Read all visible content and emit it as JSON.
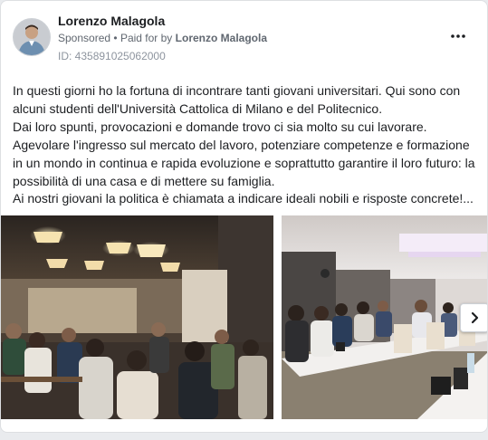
{
  "post": {
    "author": "Lorenzo Malagola",
    "sponsored_label": "Sponsored",
    "separator": "•",
    "paid_for_by_prefix": "Paid for by",
    "paid_for_by_name": "Lorenzo Malagola",
    "ad_id": "ID: 435891025062000",
    "more_icon": "more-horizontal-icon"
  },
  "body_lines": [
    "In questi giorni ho la fortuna di incontrare tanti giovani universitari. Qui sono con",
    "alcuni studenti dell'Università Cattolica di Milano e del Politecnico.",
    "Dai loro spunti, provocazioni e domande trovo ci sia molto su cui lavorare.",
    "Agevolare l'ingresso sul mercato del lavoro, potenziare competenze e formazione",
    "in un mondo in continua e rapida evoluzione e soprattutto garantire il loro futuro: la",
    "possibilità di una casa e di mettere su famiglia.",
    "Ai nostri giovani la politica è chiamata a indicare ideali nobili e risposte concrete!..."
  ],
  "carousel": {
    "photos": [
      "restaurant-students-photo",
      "long-table-students-photo"
    ],
    "next_icon": "chevron-right-icon"
  }
}
